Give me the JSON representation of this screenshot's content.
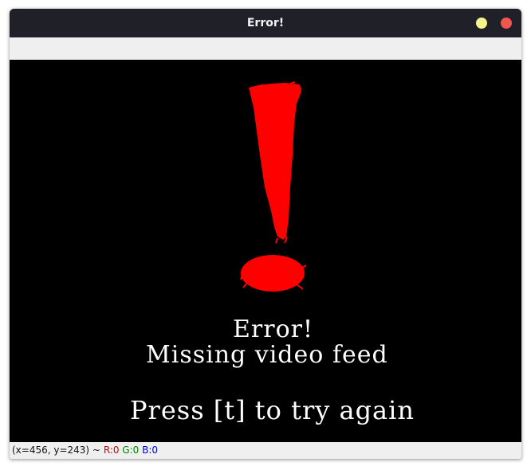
{
  "window": {
    "title": "Error!",
    "minimize_color": "#f3f48b",
    "close_color": "#f2564f"
  },
  "canvas": {
    "line1": "Error!",
    "line2": "Missing video feed",
    "line3": "Press [t] to try again",
    "mark_color": "#ff0000",
    "text_color": "#ffffff"
  },
  "status": {
    "coords": "(x=456, y=243) ~",
    "r": "R:0",
    "g": "G:0",
    "b": "B:0",
    "r_color": "#d00000",
    "g_color": "#008000",
    "b_color": "#0000cc"
  }
}
